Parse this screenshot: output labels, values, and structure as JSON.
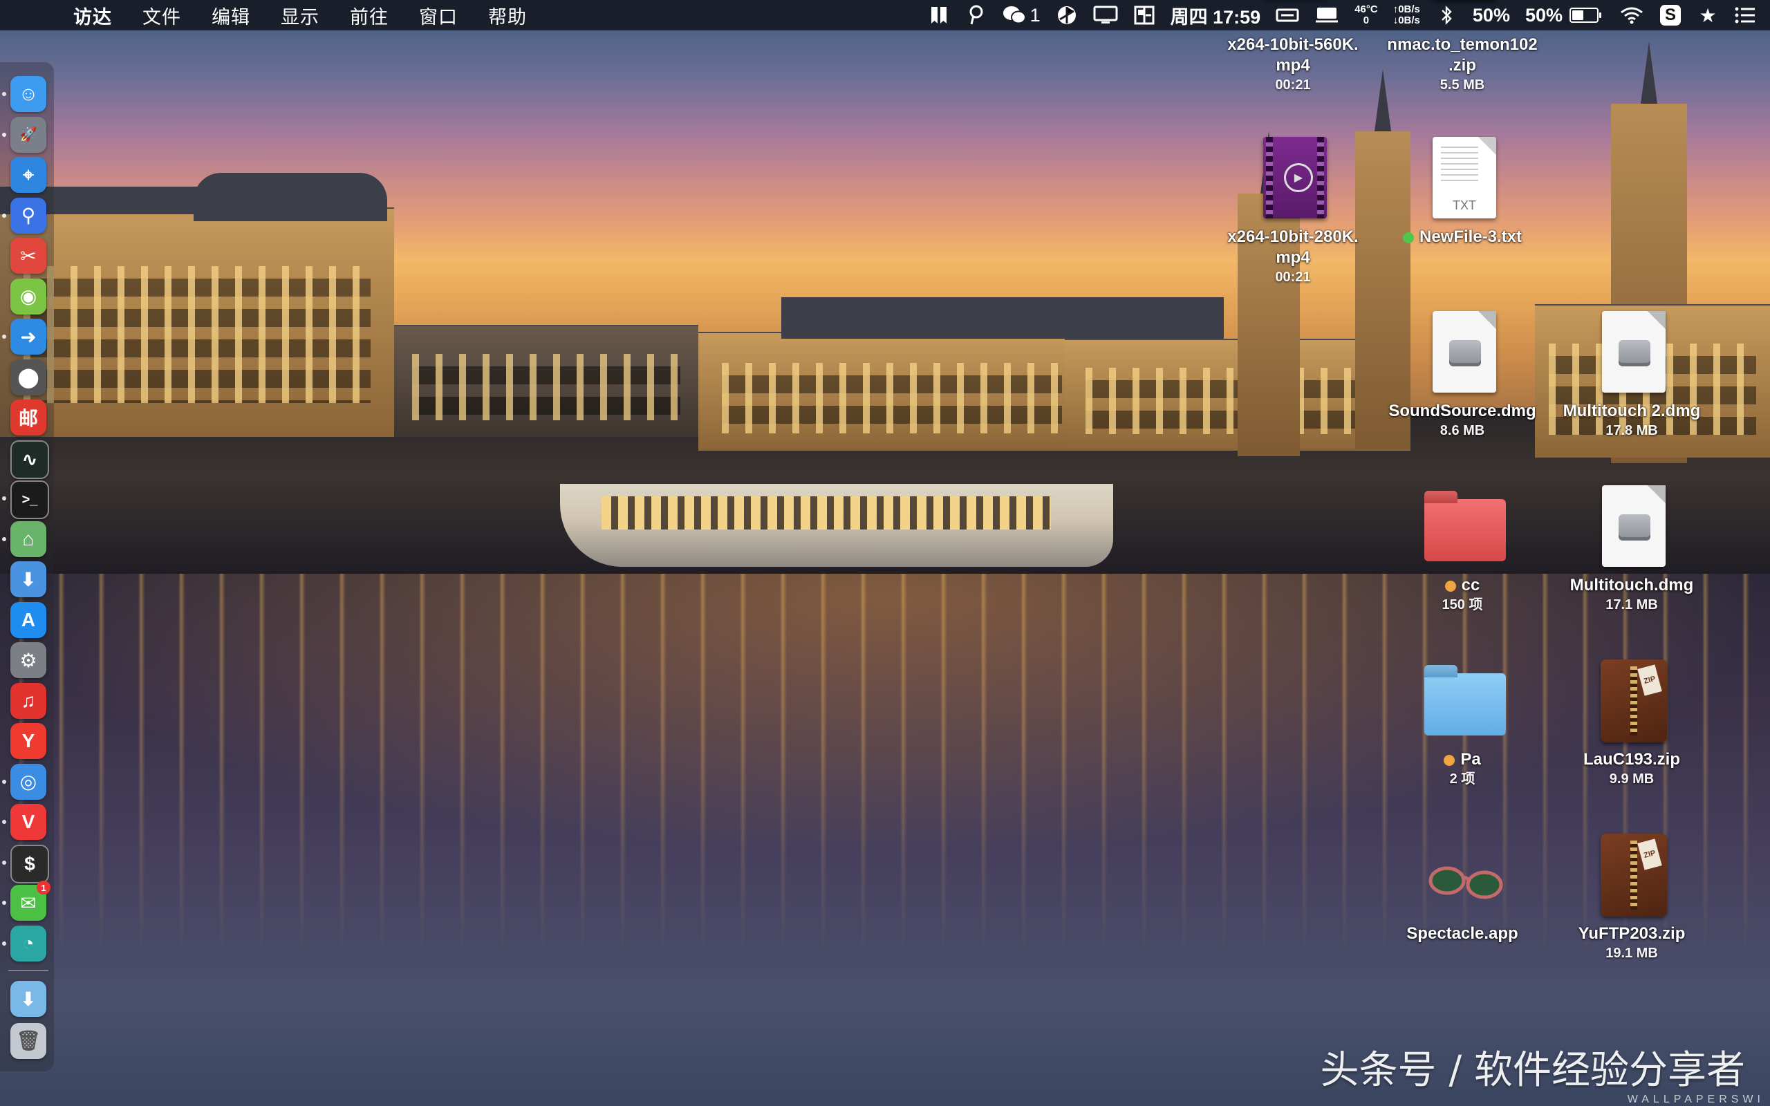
{
  "menubar": {
    "apple": "",
    "items": [
      "访达",
      "文件",
      "编辑",
      "显示",
      "前往",
      "窗口",
      "帮助"
    ],
    "status": {
      "wechat_count": "1",
      "datetime": "周四 17:59",
      "temp_top": "46°C",
      "temp_bottom": "0",
      "net_up": "↑0B/s",
      "net_down": "↓0B/s",
      "cpu_percent": "50%",
      "battery_percent": "50%",
      "battery_level": 0.5
    }
  },
  "dock": {
    "apps": [
      {
        "name": "finder",
        "glyph": "☺",
        "color": "#3d9cf0"
      },
      {
        "name": "launchpad",
        "glyph": "🚀",
        "color": "#7a7f89"
      },
      {
        "name": "safari",
        "glyph": "⌖",
        "color": "#2f86e0"
      },
      {
        "name": "contacts-search",
        "glyph": "⚲",
        "color": "#3b73e6"
      },
      {
        "name": "scissor-app",
        "glyph": "✂",
        "color": "#e2473e"
      },
      {
        "name": "android-emulator",
        "glyph": "◉",
        "color": "#7cc444"
      },
      {
        "name": "migration",
        "glyph": "➜",
        "color": "#2d8be3"
      },
      {
        "name": "disk-tool",
        "glyph": "⬤",
        "color": "#555"
      },
      {
        "name": "mail-app",
        "glyph": "邮",
        "color": "#e03a2e"
      },
      {
        "name": "activity-monitor",
        "glyph": "∿",
        "color": "#1f2b26"
      },
      {
        "name": "terminal",
        "glyph": ">_",
        "color": "#1b1b1b"
      },
      {
        "name": "maps",
        "glyph": "⌂",
        "color": "#69b36a"
      },
      {
        "name": "app-assistant",
        "glyph": "⬇",
        "color": "#4a93e0"
      },
      {
        "name": "app-store",
        "glyph": "A",
        "color": "#1f8cf0"
      },
      {
        "name": "system-preferences",
        "glyph": "⚙",
        "color": "#7c7f85"
      },
      {
        "name": "music-app",
        "glyph": "♫",
        "color": "#e2322e"
      },
      {
        "name": "yandex-browser",
        "glyph": "Y",
        "color": "#ef3b2f"
      },
      {
        "name": "chrome",
        "glyph": "◎",
        "color": "#3b8de3"
      },
      {
        "name": "vivaldi",
        "glyph": "V",
        "color": "#ef3939"
      },
      {
        "name": "iterm",
        "glyph": "$",
        "color": "#2a2a2a"
      },
      {
        "name": "wechat",
        "glyph": "✉",
        "color": "#4cbf45"
      },
      {
        "name": "screenshot-tool",
        "glyph": "◔",
        "color": "#2aa7a3"
      }
    ],
    "wechat_badge": "1",
    "downloads_glyph": "⬇",
    "trash_glyph": "🗑"
  },
  "desktop": {
    "items": [
      {
        "id": "mp4-560",
        "type": "video",
        "label": "x264-10bit-560K.\nmp4",
        "sub": "00:21"
      },
      {
        "id": "nmac-zip",
        "type": "zip",
        "label": "nmac.to_temon102\n.zip",
        "sub": "5.5 MB"
      },
      {
        "id": "mp4-280",
        "type": "video",
        "label": "x264-10bit-280K.\nmp4",
        "sub": "00:21"
      },
      {
        "id": "newfile",
        "type": "txt",
        "label": "NewFile-3.txt",
        "sub": "",
        "tag": "#4ec74a",
        "ext": "TXT"
      },
      {
        "id": "soundsource",
        "type": "dmg",
        "label": "SoundSource.dmg",
        "sub": "8.6 MB"
      },
      {
        "id": "multitouch2",
        "type": "dmg",
        "label": "Multitouch 2.dmg",
        "sub": "17.8 MB"
      },
      {
        "id": "cc-folder",
        "type": "folder-red",
        "label": "cc",
        "sub": "150 项",
        "tag": "#f0a540"
      },
      {
        "id": "multitouch",
        "type": "dmg",
        "label": "Multitouch.dmg",
        "sub": "17.1 MB"
      },
      {
        "id": "pa-folder",
        "type": "folder-blue",
        "label": "Pa",
        "sub": "2 项",
        "tag": "#f0a540"
      },
      {
        "id": "lauc-zip",
        "type": "zip",
        "label": "LauC193.zip",
        "sub": "9.9 MB"
      },
      {
        "id": "spectacle",
        "type": "app",
        "label": "Spectacle.app",
        "sub": ""
      },
      {
        "id": "yuftp-zip",
        "type": "zip",
        "label": "YuFTP203.zip",
        "sub": "19.1 MB"
      }
    ],
    "zip_tag": "ZIP"
  },
  "watermark": "头条号 / 软件经验分享者",
  "wall_credit": "WALLPAPERSWI"
}
